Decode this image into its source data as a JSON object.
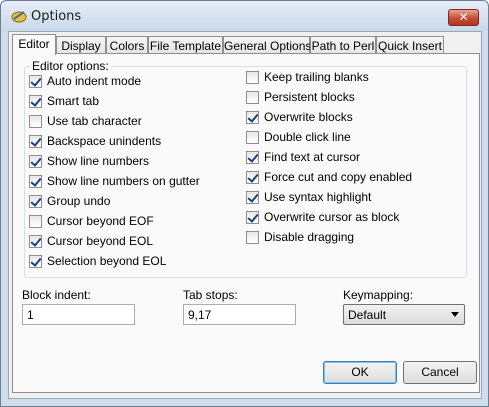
{
  "window": {
    "title": "Options",
    "close_label": "✕"
  },
  "tabs": [
    {
      "label": "Editor",
      "active": true
    },
    {
      "label": "Display"
    },
    {
      "label": "Colors"
    },
    {
      "label": "File Template"
    },
    {
      "label": "General Options"
    },
    {
      "label": "Path to Perl"
    },
    {
      "label": "Quick Insert"
    }
  ],
  "editor_options": {
    "legend": "Editor options:",
    "left": [
      {
        "label": "Auto indent mode",
        "checked": true
      },
      {
        "label": "Smart tab",
        "checked": true
      },
      {
        "label": "Use tab character",
        "checked": false
      },
      {
        "label": "Backspace unindents",
        "checked": true
      },
      {
        "label": "Show line numbers",
        "checked": true
      },
      {
        "label": "Show line numbers on gutter",
        "checked": true
      },
      {
        "label": "Group undo",
        "checked": true
      },
      {
        "label": "Cursor beyond EOF",
        "checked": false
      },
      {
        "label": "Cursor beyond EOL",
        "checked": true
      },
      {
        "label": "Selection beyond EOL",
        "checked": true
      }
    ],
    "right": [
      {
        "label": "Keep trailing blanks",
        "checked": false
      },
      {
        "label": "Persistent blocks",
        "checked": false
      },
      {
        "label": "Overwrite blocks",
        "checked": true
      },
      {
        "label": "Double click line",
        "checked": false
      },
      {
        "label": "Find text at cursor",
        "checked": true
      },
      {
        "label": "Force cut and copy enabled",
        "checked": true
      },
      {
        "label": "Use syntax highlight",
        "checked": true
      },
      {
        "label": "Overwrite cursor as block",
        "checked": true
      },
      {
        "label": "Disable dragging",
        "checked": false
      }
    ]
  },
  "block_indent": {
    "label": "Block indent:",
    "value": "1"
  },
  "tab_stops": {
    "label": "Tab stops:",
    "value": "9,17"
  },
  "keymapping": {
    "label": "Keymapping:",
    "value": "Default"
  },
  "buttons": {
    "ok": "OK",
    "cancel": "Cancel"
  }
}
